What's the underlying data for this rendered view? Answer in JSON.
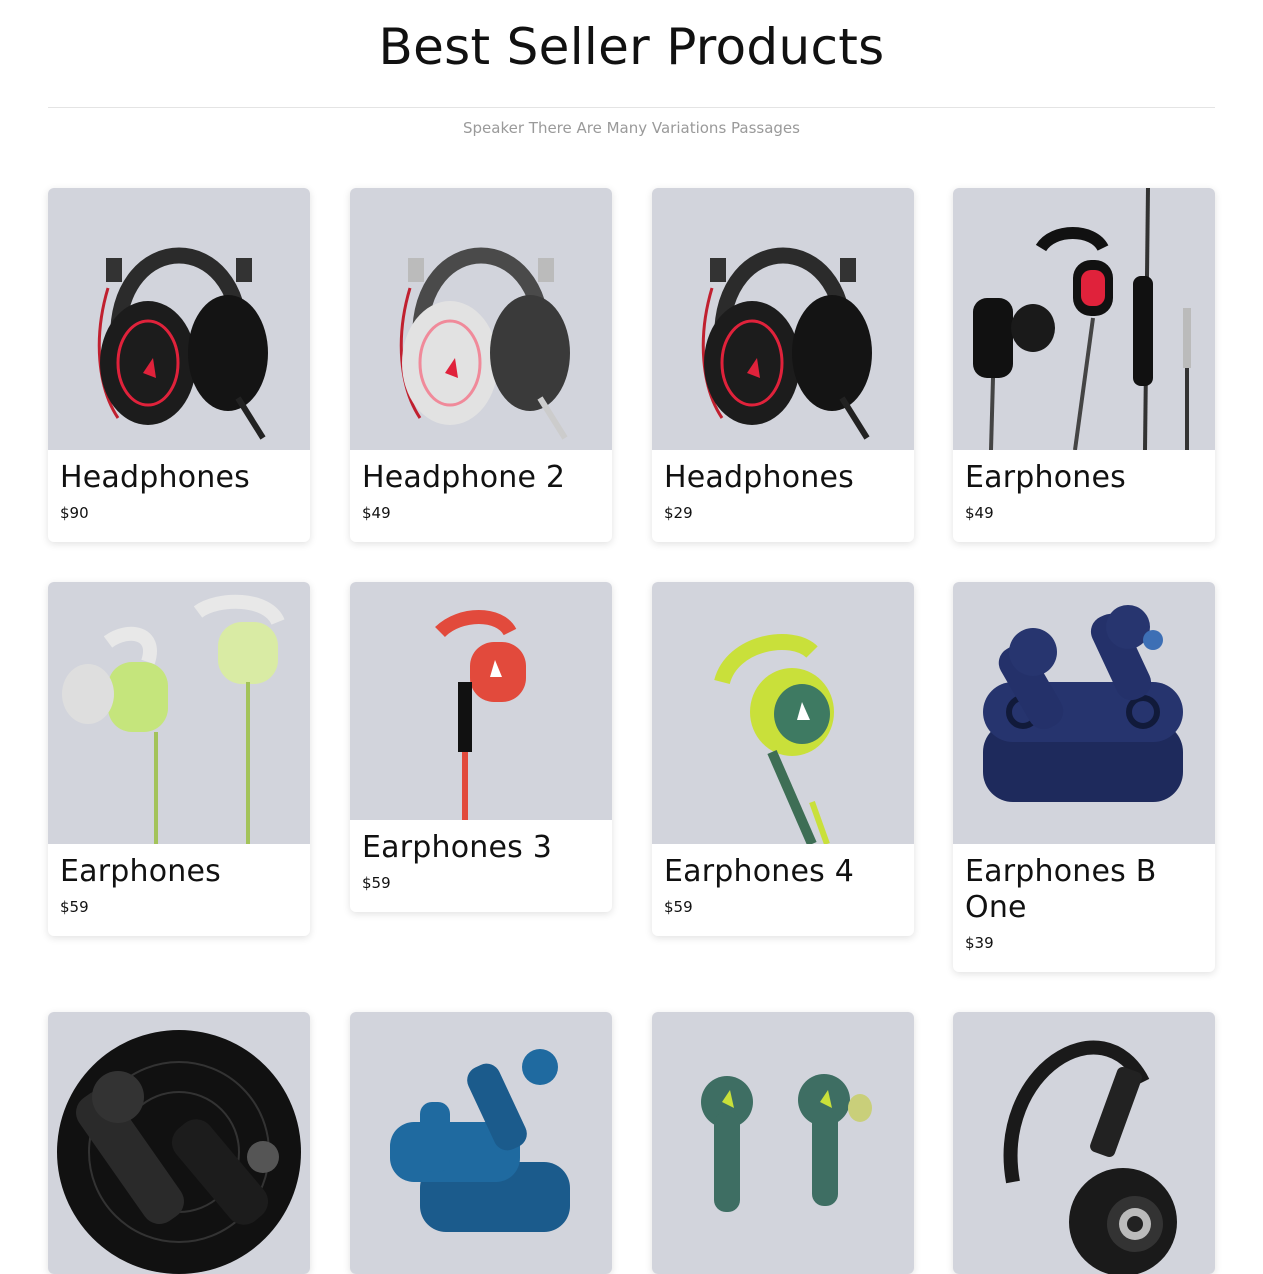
{
  "header": {
    "title": "Best Seller Products",
    "subtitle": "Speaker There Are Many Variations Passages"
  },
  "products": [
    {
      "name": "Headphones",
      "price": "$90",
      "image_icon": "headphones-icon",
      "accent": "#e0223b"
    },
    {
      "name": "Headphone 2",
      "price": "$49",
      "image_icon": "headphones-icon",
      "accent": "#e0223b"
    },
    {
      "name": "Headphones",
      "price": "$29",
      "image_icon": "headphones-icon",
      "accent": "#e0223b"
    },
    {
      "name": "Earphones",
      "price": "$49",
      "image_icon": "earphones-icon",
      "accent": "#e0223b"
    },
    {
      "name": "Earphones",
      "price": "$59",
      "image_icon": "earphones-icon",
      "accent": "#b5d96a"
    },
    {
      "name": "Earphones 3",
      "price": "$59",
      "image_icon": "earphones-icon",
      "accent": "#e24a3c"
    },
    {
      "name": "Earphones 4",
      "price": "$59",
      "image_icon": "earphones-icon",
      "accent": "#c9e03a"
    },
    {
      "name": "Earphones B One",
      "price": "$39",
      "image_icon": "earbuds-case-icon",
      "accent": "#1e2a5c"
    },
    {
      "name": "",
      "price": "",
      "image_icon": "earbuds-icon",
      "accent": "#222222"
    },
    {
      "name": "",
      "price": "",
      "image_icon": "earbuds-case-icon",
      "accent": "#1b5b8c"
    },
    {
      "name": "",
      "price": "",
      "image_icon": "earbuds-icon",
      "accent": "#3e6e63"
    },
    {
      "name": "",
      "price": "",
      "image_icon": "headphones-icon",
      "accent": "#1a1a1a"
    }
  ]
}
